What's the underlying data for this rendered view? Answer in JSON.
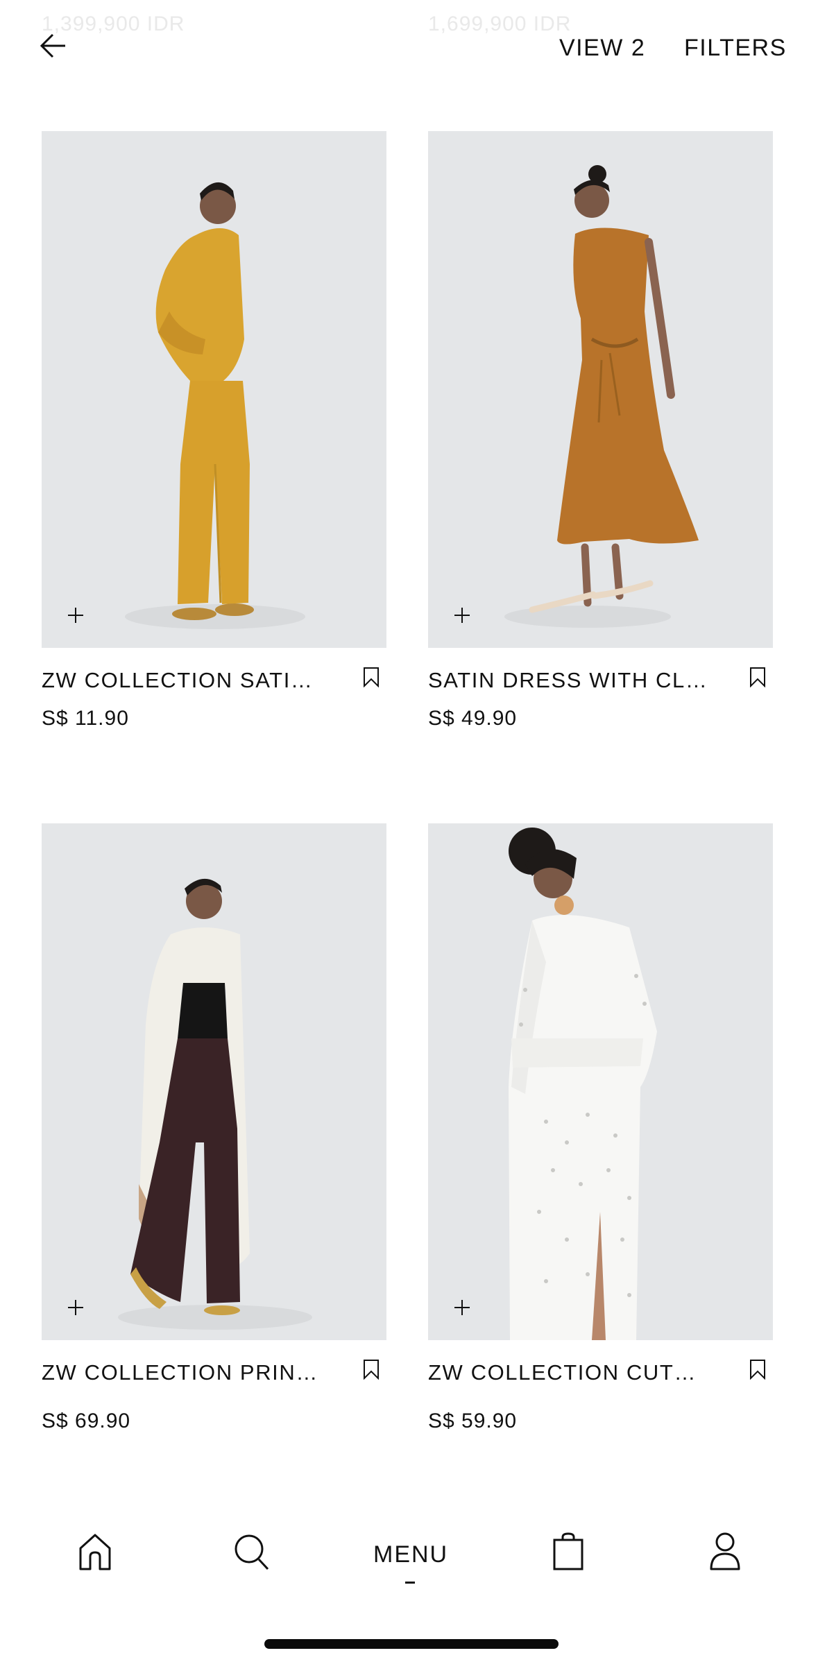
{
  "header": {
    "ghost_prices": [
      "1,399,900 IDR",
      "1,699,900 IDR"
    ],
    "view_label": "VIEW 2",
    "filters_label": "FILTERS"
  },
  "products": [
    {
      "name": "ZW COLLECTION SATIN...",
      "price": "S$ 11.90",
      "outfit": "mustard satin shirt and trousers"
    },
    {
      "name": "SATIN DRESS WITH CLASP",
      "price": "S$ 49.90",
      "outfit": "copper satin dress"
    },
    {
      "name": "ZW COLLECTION PRINT...",
      "price": "S$ 69.90",
      "outfit": "ivory printed coat, black top, brown trousers"
    },
    {
      "name": "ZW COLLECTION CUTW...",
      "price": "S$ 59.90",
      "outfit": "white cutwork dress"
    }
  ],
  "bottom_nav": {
    "menu_label": "MENU",
    "icons": [
      "home-icon",
      "search-icon",
      "shopping-bag-icon",
      "user-icon"
    ]
  },
  "colors": {
    "text": "#111111",
    "photo_bg": "#e2e4e6",
    "mustard": "#d9a42f",
    "copper": "#b8732a"
  }
}
